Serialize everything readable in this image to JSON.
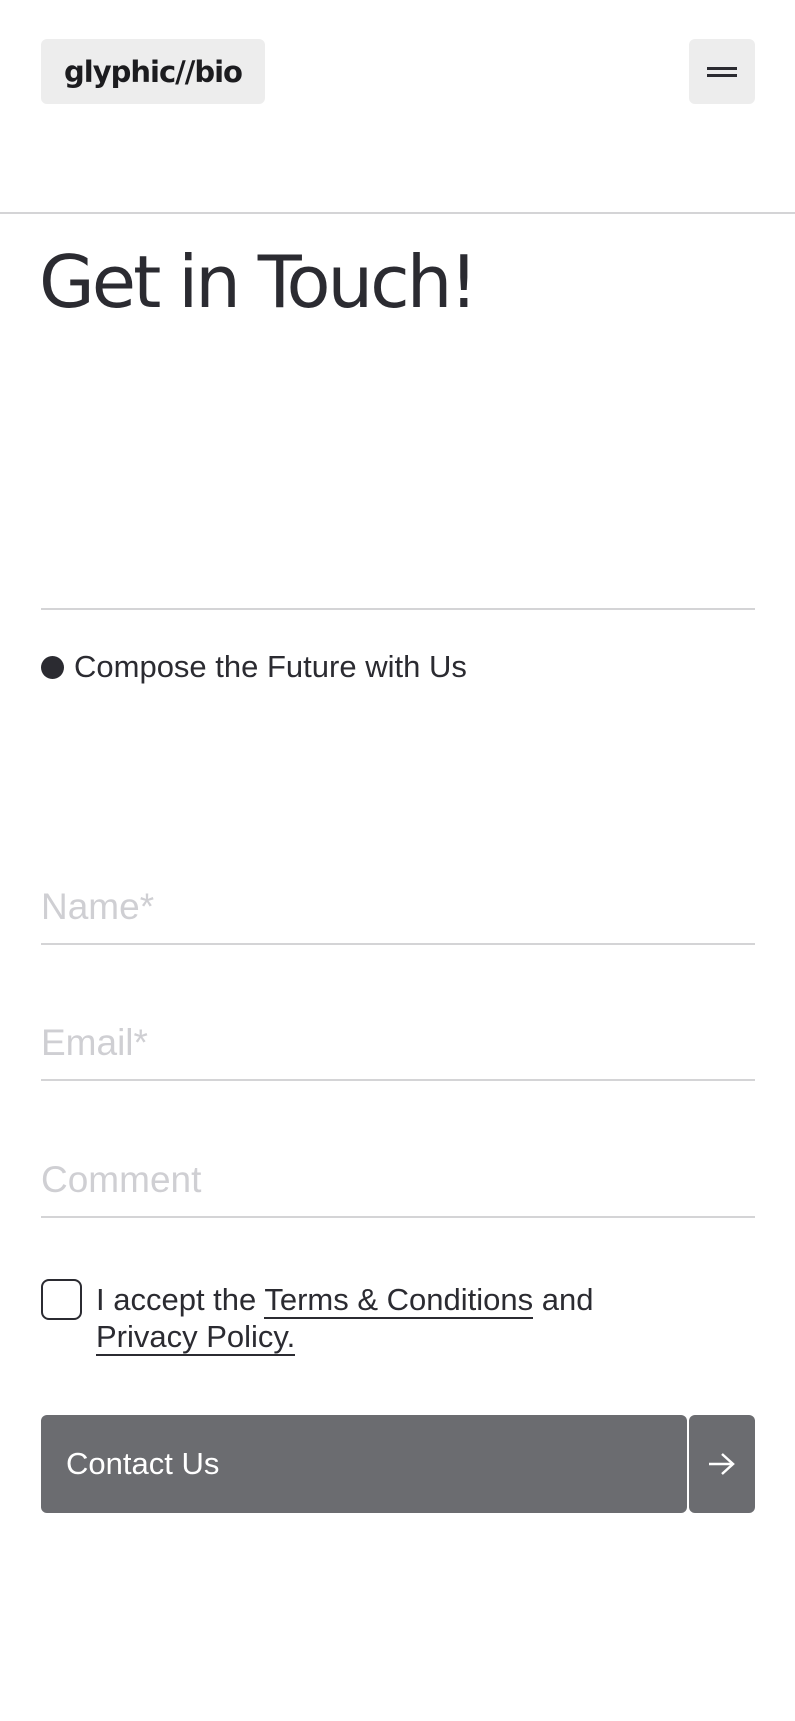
{
  "header": {
    "logo_text": "glyphic//bio",
    "menu_icon": "menu-icon"
  },
  "hero": {
    "title": "Get in Touch!"
  },
  "section": {
    "subtitle": "Compose the Future with Us"
  },
  "form": {
    "name_placeholder": "Name*",
    "email_placeholder": "Email*",
    "comment_placeholder": "Comment",
    "name_value": "",
    "email_value": "",
    "comment_value": "",
    "terms_prefix": "I accept the",
    "terms_link": "Terms & Conditions",
    "terms_middle": "and",
    "privacy_link": "Privacy Policy.",
    "terms_checked": false,
    "submit_label": "Contact Us",
    "submit_icon": "arrow-right-icon"
  },
  "colors": {
    "text": "#2b2b31",
    "button": "#6b6c70",
    "chip": "#ededed",
    "rule": "#d4d4d6",
    "placeholder": "#cfcfd3"
  }
}
